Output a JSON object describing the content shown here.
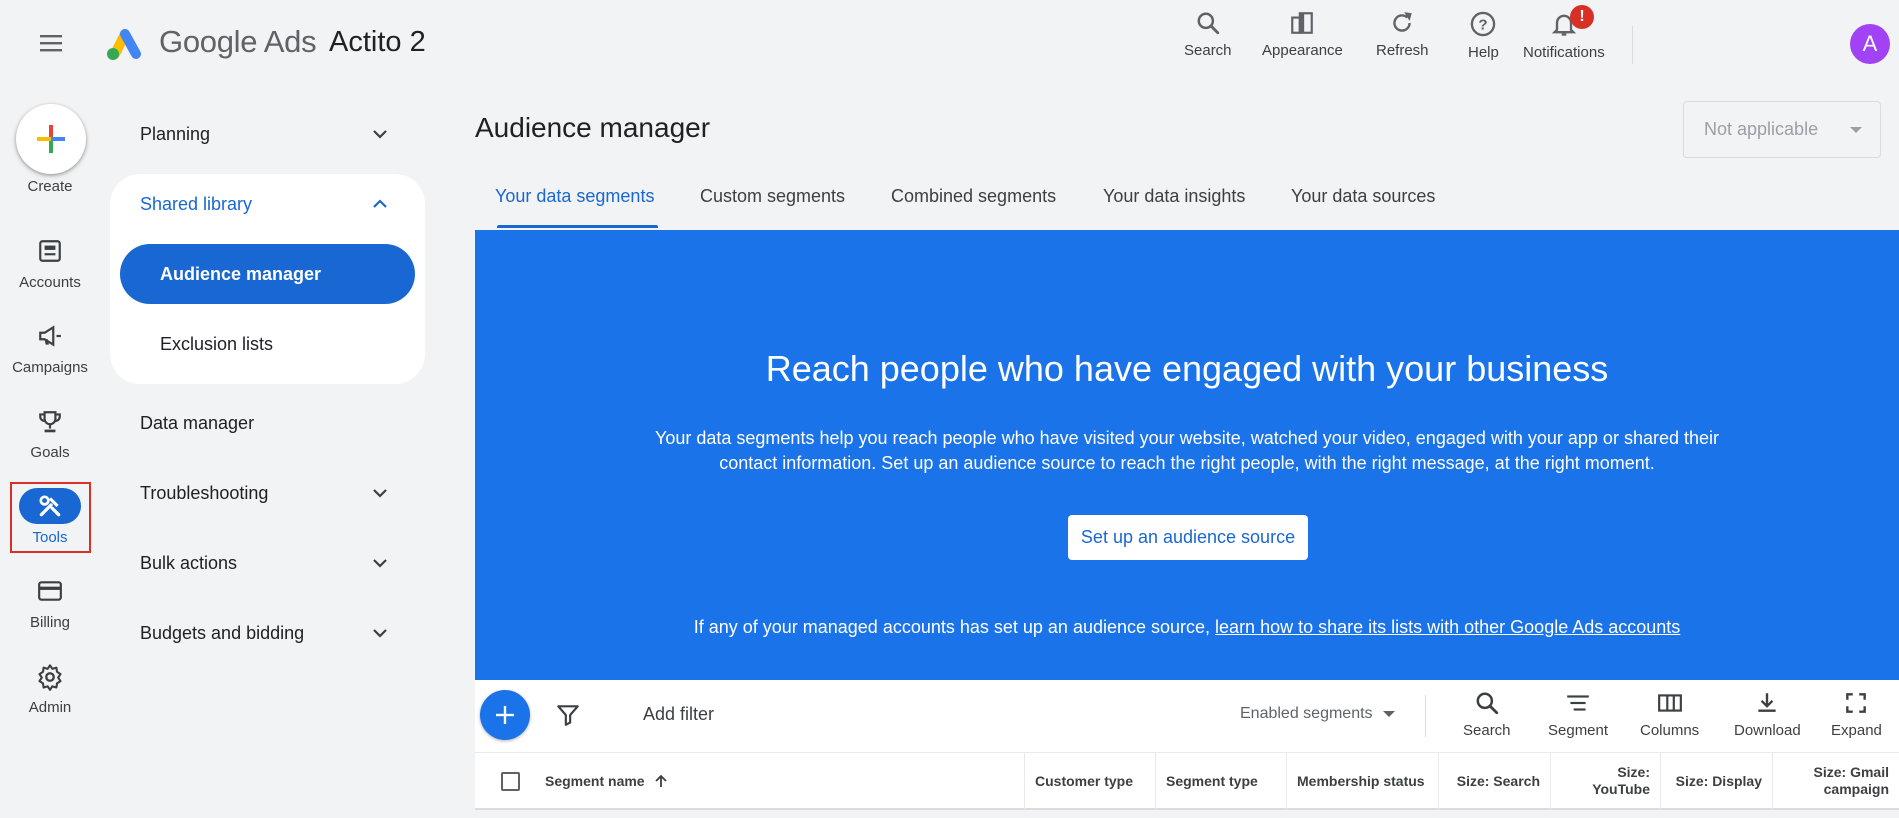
{
  "header": {
    "brand_google": "Google",
    "brand_ads": "Ads",
    "account_name": "Actito 2",
    "actions": [
      {
        "label": "Search",
        "icon": "search-icon"
      },
      {
        "label": "Appearance",
        "icon": "appearance-icon"
      },
      {
        "label": "Refresh",
        "icon": "refresh-icon"
      },
      {
        "label": "Help",
        "icon": "help-icon"
      },
      {
        "label": "Notifications",
        "icon": "bell-icon"
      }
    ],
    "notification_badge": "!",
    "avatar_initial": "A"
  },
  "rail": {
    "create_label": "Create",
    "items": [
      {
        "label": "Accounts",
        "icon": "accounts-icon"
      },
      {
        "label": "Campaigns",
        "icon": "megaphone-icon"
      },
      {
        "label": "Goals",
        "icon": "trophy-icon"
      },
      {
        "label": "Tools",
        "icon": "tools-icon",
        "active": true
      },
      {
        "label": "Billing",
        "icon": "credit-card-icon"
      },
      {
        "label": "Admin",
        "icon": "gear-icon"
      }
    ]
  },
  "nav": {
    "planning": "Planning",
    "shared_library": "Shared library",
    "audience_manager": "Audience manager",
    "exclusion_lists": "Exclusion lists",
    "data_manager": "Data manager",
    "troubleshooting": "Troubleshooting",
    "bulk_actions": "Bulk actions",
    "budgets_bidding": "Budgets and bidding"
  },
  "main": {
    "title": "Audience manager",
    "scope_select": "Not applicable",
    "tabs": [
      {
        "label": "Your data segments",
        "active": true
      },
      {
        "label": "Custom segments"
      },
      {
        "label": "Combined segments"
      },
      {
        "label": "Your data insights"
      },
      {
        "label": "Your data sources"
      }
    ]
  },
  "banner": {
    "title": "Reach people who have engaged with your business",
    "text": "Your data segments help you reach people who have visited your website, watched your video, engaged with your app or shared their contact information. Set up an audience source to reach the right people, with the right message, at the right moment.",
    "button": "Set up an audience source",
    "footer_prefix": "If any of your managed accounts has set up an audience source, ",
    "footer_link": "learn how to share its lists with other Google Ads accounts"
  },
  "toolbar": {
    "add_filter": "Add filter",
    "segments_filter": "Enabled segments",
    "actions": [
      {
        "label": "Search",
        "icon": "search-icon"
      },
      {
        "label": "Segment",
        "icon": "segment-icon"
      },
      {
        "label": "Columns",
        "icon": "columns-icon"
      },
      {
        "label": "Download",
        "icon": "download-icon"
      },
      {
        "label": "Expand",
        "icon": "expand-icon"
      }
    ]
  },
  "table": {
    "columns": [
      "Segment name",
      "Customer type",
      "Segment type",
      "Membership status",
      "Size: Search",
      "Size: YouTube",
      "Size: Display",
      "Size: Gmail campaign"
    ],
    "sort": "ascending"
  },
  "colors": {
    "primary": "#1a73e8",
    "nav_active": "#1967d2",
    "highlight_border": "#d93025",
    "avatar": "#a142f4"
  }
}
